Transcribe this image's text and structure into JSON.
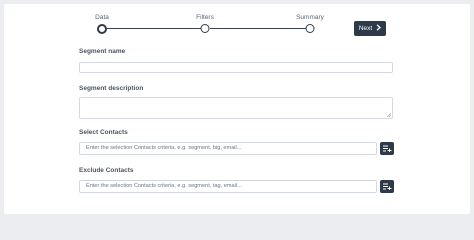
{
  "stepper": {
    "steps": [
      {
        "label": "Data",
        "state": "active"
      },
      {
        "label": "Filters",
        "state": "pending"
      },
      {
        "label": "Summary",
        "state": "pending"
      }
    ],
    "next_label": "Next"
  },
  "form": {
    "segment_name": {
      "label": "Segment name",
      "value": ""
    },
    "segment_description": {
      "label": "Segment description",
      "value": ""
    },
    "select_contacts": {
      "label": "Select Contacts",
      "placeholder": "Enter the selection Contacts criteria, e.g. segment, big, email..."
    },
    "exclude_contacts": {
      "label": "Exclude Contacts",
      "placeholder": "Enter the selection Contacts criteria, e.g. segment, tag, email..."
    }
  },
  "icons": {
    "next": "chevron-right-icon",
    "list_add": "playlist-add-icon"
  },
  "colors": {
    "primary_dark": "#2d3a4a",
    "background": "#ebedf0",
    "border": "#d3d8de"
  }
}
